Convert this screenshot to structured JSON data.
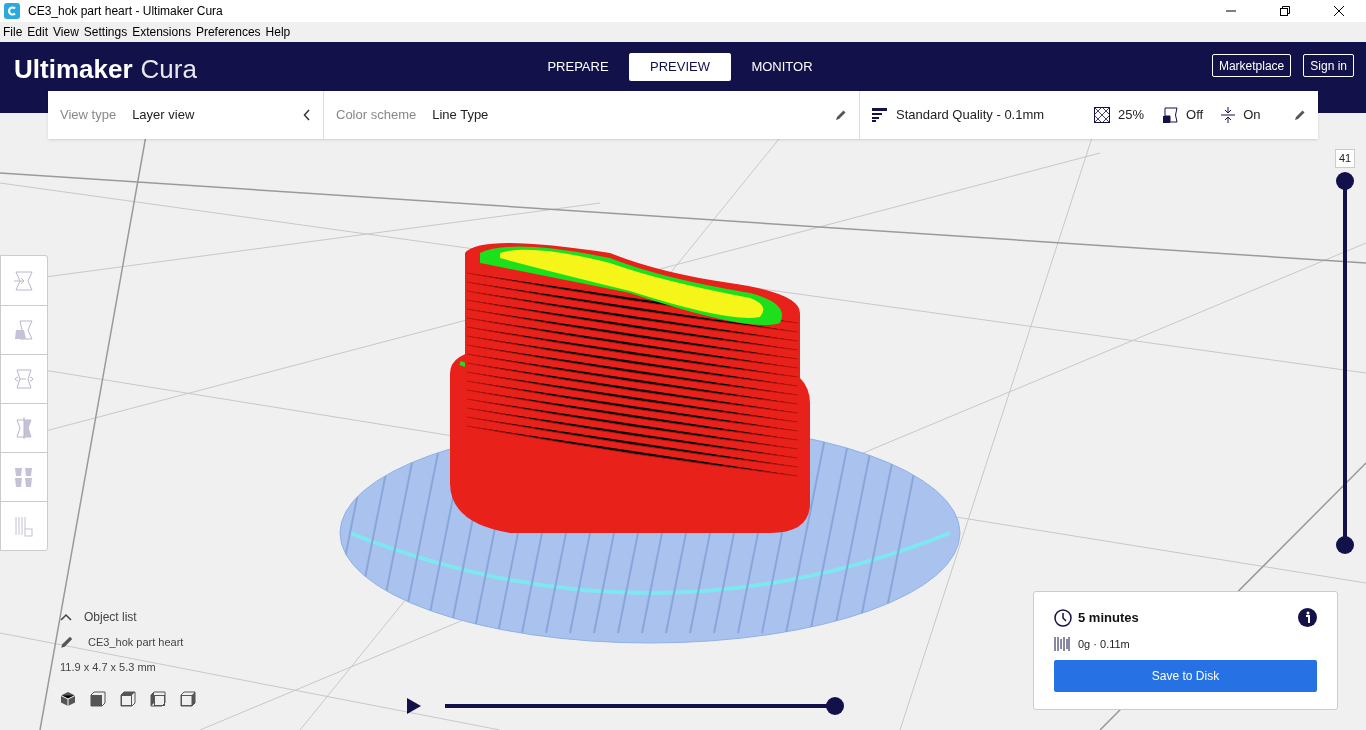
{
  "window": {
    "title": "CE3_hok part heart - Ultimaker Cura"
  },
  "menu": [
    "File",
    "Edit",
    "View",
    "Settings",
    "Extensions",
    "Preferences",
    "Help"
  ],
  "header": {
    "logo_bold": "Ultimaker",
    "logo_light": "Cura",
    "stages": [
      {
        "label": "PREPARE",
        "selected": false
      },
      {
        "label": "PREVIEW",
        "selected": true
      },
      {
        "label": "MONITOR",
        "selected": false
      }
    ],
    "buttons": [
      "Marketplace",
      "Sign in"
    ]
  },
  "toolbar": {
    "view_type_label": "View type",
    "view_type": "Layer view",
    "color_scheme_label": "Color scheme",
    "color_scheme": "Line Type",
    "profile": "Standard Quality - 0.1mm",
    "infill": "25%",
    "support": "Off",
    "adhesion": "On"
  },
  "tools": [
    {
      "kind": "move"
    },
    {
      "kind": "scale"
    },
    {
      "kind": "rotate"
    },
    {
      "kind": "mirror"
    },
    {
      "kind": "per-model"
    },
    {
      "kind": "support-blocker"
    }
  ],
  "layer_slider": {
    "value": "41",
    "level": 1
  },
  "object_list": {
    "toggle": "Object list",
    "object_name": "CE3_hok part heart",
    "dimensions": "11.9 x 4.7 x 5.3 mm",
    "view_buttons": [
      {
        "kind": "isometric"
      },
      {
        "kind": "front"
      },
      {
        "kind": "top"
      },
      {
        "kind": "left"
      },
      {
        "kind": "right"
      }
    ]
  },
  "playback": {
    "level": 1
  },
  "print_info": {
    "time": "5 minutes",
    "material": "0g · 0.11m",
    "button": "Save to Disk"
  }
}
